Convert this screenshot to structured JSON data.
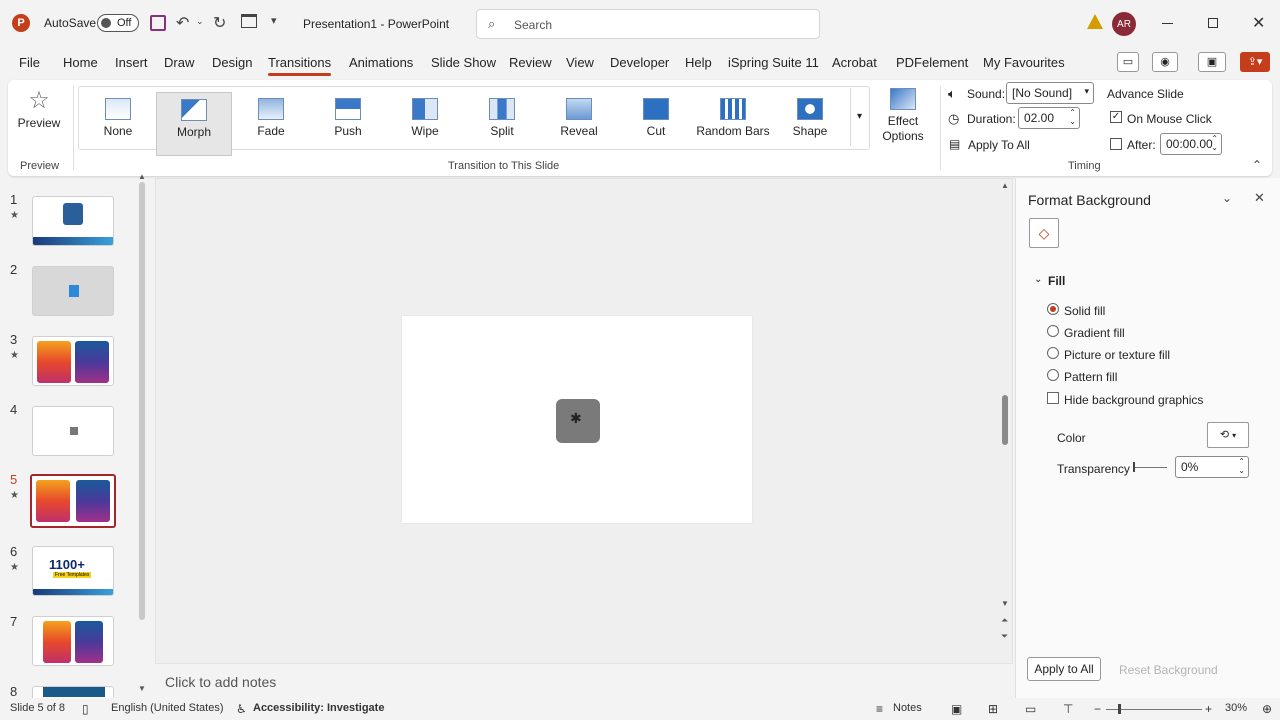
{
  "titlebar": {
    "autosave_label": "AutoSave",
    "autosave_state": "Off",
    "doc_title": "Presentation1 - PowerPoint",
    "search_placeholder": "Search",
    "avatar_initials": "AR"
  },
  "menu": {
    "tabs": [
      "File",
      "Home",
      "Insert",
      "Draw",
      "Design",
      "Transitions",
      "Animations",
      "Slide Show",
      "Review",
      "View",
      "Developer",
      "Help",
      "iSpring Suite 11",
      "Acrobat",
      "PDFelement",
      "My Favourites"
    ],
    "active": "Transitions"
  },
  "ribbon": {
    "preview_label": "Preview",
    "preview_group": "Preview",
    "transitions": [
      "None",
      "Morph",
      "Fade",
      "Push",
      "Wipe",
      "Split",
      "Reveal",
      "Cut",
      "Random Bars",
      "Shape"
    ],
    "selected_transition": "Morph",
    "effect_options": "Effect Options",
    "transition_group": "Transition to This Slide",
    "sound_label": "Sound:",
    "sound_value": "[No Sound]",
    "duration_label": "Duration:",
    "duration_value": "02.00",
    "apply_all": "Apply To All",
    "advance_label": "Advance Slide",
    "on_mouse_click": "On Mouse Click",
    "after_label": "After:",
    "after_value": "00:00.00",
    "timing_group": "Timing"
  },
  "slides": [
    {
      "num": "1",
      "star": true
    },
    {
      "num": "2",
      "star": false
    },
    {
      "num": "3",
      "star": true
    },
    {
      "num": "4",
      "star": false
    },
    {
      "num": "5",
      "star": true
    },
    {
      "num": "6",
      "star": true,
      "text": "1100+",
      "subtext": "Free Templates"
    },
    {
      "num": "7",
      "star": false
    },
    {
      "num": "8",
      "star": false
    }
  ],
  "selected_slide": 5,
  "notes_placeholder": "Click to add notes",
  "format_panel": {
    "title": "Format Background",
    "section": "Fill",
    "options": [
      "Solid fill",
      "Gradient fill",
      "Picture or texture fill",
      "Pattern fill"
    ],
    "selected": "Solid fill",
    "hide_bg": "Hide background graphics",
    "color_label": "Color",
    "transparency_label": "Transparency",
    "transparency_value": "0%",
    "apply_all": "Apply to All",
    "reset": "Reset Background"
  },
  "statusbar": {
    "slide_info": "Slide 5 of 8",
    "language": "English (United States)",
    "accessibility": "Accessibility: Investigate",
    "notes": "Notes",
    "zoom": "30%"
  },
  "colors": {
    "accent": "#c43e1c",
    "brand": "#c43e1c"
  }
}
